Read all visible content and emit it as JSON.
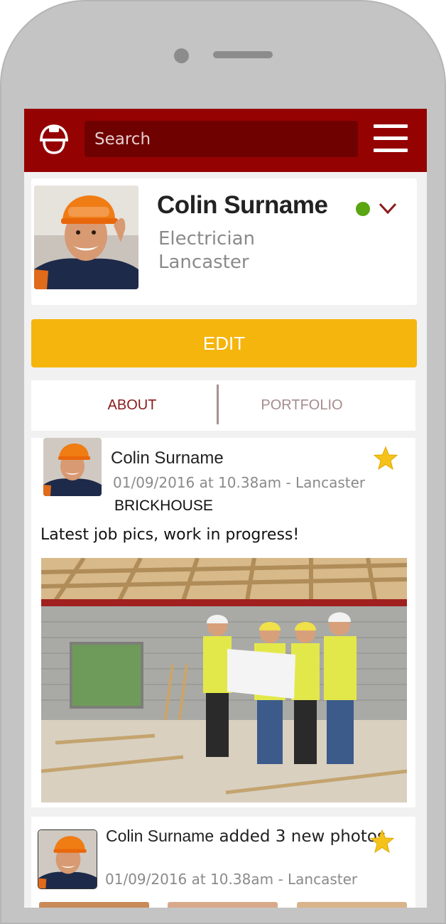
{
  "header": {
    "search_placeholder": "Search",
    "logo_icon": "hard-hat-icon",
    "menu_icon": "hamburger-menu-icon",
    "color": "#950202"
  },
  "profile": {
    "name": "Colin Surname",
    "job": "Electrician",
    "town": "Lancaster",
    "status_color": "#5aa512",
    "status_icon": "online-status-dot-icon",
    "chevron_icon": "chevron-down-icon"
  },
  "edit_button": {
    "label": "EDIT",
    "color": "#f5b50d"
  },
  "tabs": [
    {
      "label": "ABOUT"
    },
    {
      "label": "PORTFOLIO"
    }
  ],
  "posts": [
    {
      "name": "Colin Surname",
      "meta": "01/09/2016 at 10.38am - Lancaster",
      "tag": "BRICKHOUSE",
      "text": "Latest job pics, work in progress!",
      "starred": true
    },
    {
      "name": "Colin Surname",
      "action": " added 3 new photos.",
      "meta": "01/09/2016 at 10.38am - Lancaster",
      "starred": true
    }
  ]
}
